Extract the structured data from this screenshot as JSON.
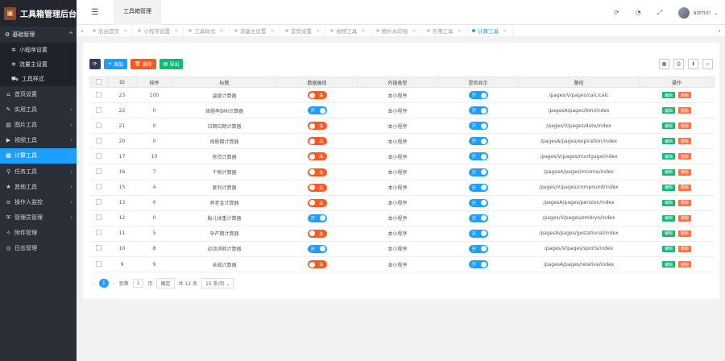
{
  "app": {
    "title": "工具箱管理后台",
    "logo_icon": "toolbox-icon"
  },
  "sidebar": {
    "group": {
      "icon": "gear-icon",
      "label": "基础管理",
      "expanded": true
    },
    "sub_items": [
      {
        "icon": "cog-icon",
        "label": "小程序设置"
      },
      {
        "icon": "cog-icon",
        "label": "流量主设置"
      },
      {
        "icon": "car-icon",
        "label": "工具样式"
      }
    ],
    "items": [
      {
        "icon": "home-icon",
        "label": "首页设置",
        "active": false
      },
      {
        "icon": "wrench-icon",
        "label": "实用工具",
        "active": false
      },
      {
        "icon": "image-icon",
        "label": "图片工具",
        "active": false
      },
      {
        "icon": "video-icon",
        "label": "视频工具",
        "active": false
      },
      {
        "icon": "calculator-icon",
        "label": "计算工具",
        "active": true
      },
      {
        "icon": "link-icon",
        "label": "任务工具",
        "active": false
      },
      {
        "icon": "star-icon",
        "label": "其他工具",
        "active": false
      },
      {
        "icon": "sliders-icon",
        "label": "操作人监控",
        "active": false
      },
      {
        "icon": "shield-icon",
        "label": "管理员管理",
        "active": false
      },
      {
        "icon": "paperclip-icon",
        "label": "附件管理",
        "active": false
      },
      {
        "icon": "log-icon",
        "label": "日志管理",
        "active": false
      }
    ]
  },
  "topbar": {
    "tab": "工具箱管理",
    "user": "admin",
    "icons": [
      "refresh-icon",
      "bell-icon",
      "fullscreen-icon"
    ]
  },
  "tabs": [
    {
      "label": "后台首页",
      "active": false
    },
    {
      "label": "小程序设置",
      "active": false
    },
    {
      "label": "工具样式",
      "active": false
    },
    {
      "label": "流量主设置",
      "active": false
    },
    {
      "label": "首页设置",
      "active": false
    },
    {
      "label": "视频工具",
      "active": false
    },
    {
      "label": "图片水印视",
      "active": false
    },
    {
      "label": "实用工具",
      "active": false
    },
    {
      "label": "计算工具",
      "active": true
    }
  ],
  "toolbar": {
    "refresh": "⟳",
    "add": "添加",
    "delete": "删除",
    "export": "导出"
  },
  "table": {
    "headers": [
      "ID",
      "排序",
      "标题",
      "数据展现",
      "外链类型",
      "是否显示",
      "路径",
      "操作"
    ],
    "rows": [
      {
        "id": "23",
        "sort": "100",
        "title": "温度计算器",
        "data": "关",
        "link": "本小程序",
        "show": "开",
        "path": "/pages/V/pages/calc/calc"
      },
      {
        "id": "22",
        "sort": "0",
        "title": "体脂率BMI计算器",
        "data": "开",
        "link": "本小程序",
        "show": "开",
        "path": "/pagesA/pages/bmi/index"
      },
      {
        "id": "21",
        "sort": "0",
        "title": "日期日期计算器",
        "data": "关",
        "link": "本小程序",
        "show": "开",
        "path": "/pages/V/pages/date/index"
      },
      {
        "id": "20",
        "sort": "0",
        "title": "保质期计算器",
        "data": "关",
        "link": "本小程序",
        "show": "开",
        "path": "/pagesA/pages/expiration/index"
      },
      {
        "id": "17",
        "sort": "10",
        "title": "房贷计算器",
        "data": "关",
        "link": "本小程序",
        "show": "开",
        "path": "/pages/V/pages/mortgage/index"
      },
      {
        "id": "16",
        "sort": "7",
        "title": "个税计算器",
        "data": "关",
        "link": "本小程序",
        "show": "开",
        "path": "/pagesA/pages/income/index"
      },
      {
        "id": "15",
        "sort": "4",
        "title": "复利计算器",
        "data": "关",
        "link": "本小程序",
        "show": "开",
        "path": "/pages/V/pages/compound/index"
      },
      {
        "id": "13",
        "sort": "0",
        "title": "养老金计算器",
        "data": "关",
        "link": "本小程序",
        "show": "开",
        "path": "/pagesA/pages/pension/index"
      },
      {
        "id": "12",
        "sort": "0",
        "title": "胎儿体重计算器",
        "data": "开",
        "link": "本小程序",
        "show": "开",
        "path": "/pages/V/pages/embryo/index"
      },
      {
        "id": "11",
        "sort": "5",
        "title": "孕产期计算器",
        "data": "关",
        "link": "本小程序",
        "show": "开",
        "path": "/pagesA/pages/gestational/index"
      },
      {
        "id": "10",
        "sort": "8",
        "title": "运动消耗计算器",
        "data": "开",
        "link": "本小程序",
        "show": "开",
        "path": "/pages/V/pages/sports/index"
      },
      {
        "id": "9",
        "sort": "9",
        "title": "亲戚计算器",
        "data": "关",
        "link": "本小程序",
        "show": "开",
        "path": "/pagesA/pages/relative/index"
      }
    ],
    "edit_label": "编辑",
    "delete_label": "删除"
  },
  "pager": {
    "current": "1",
    "goto_label": "到第",
    "page_value": "1",
    "page_unit": "页",
    "confirm": "确定",
    "total": "共 12 条",
    "per_page": "15 条/页"
  }
}
